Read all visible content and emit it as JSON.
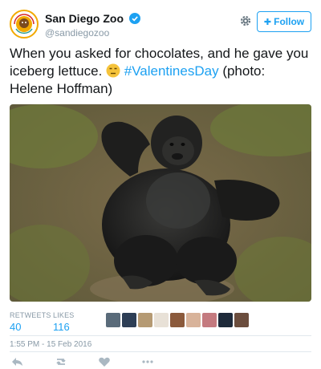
{
  "tweet": {
    "display_name": "San Diego Zoo",
    "handle": "@sandiegozoo",
    "follow_label": "Follow",
    "text_part1": "When you asked for chocolates, and he gave you iceberg lettuce. ",
    "hashtag": "#ValentinesDay",
    "text_part2": " (photo: Helene Hoffman)",
    "timestamp": "1:55 PM - 15 Feb 2016"
  },
  "stats": {
    "retweets_label": "RETWEETS",
    "retweets_value": "40",
    "likes_label": "LIKES",
    "likes_value": "116"
  },
  "liker_avatars": [
    "#5a6b7a",
    "#2d3e55",
    "#b59a73",
    "#e8e1d7",
    "#8b5a3c",
    "#d8b39a",
    "#c47a7f",
    "#1e2a3a",
    "#6b4d3d"
  ],
  "icons": {
    "verified": "verified-badge-icon",
    "settings": "gear-icon",
    "follow": "add-user-icon",
    "emoji": "unamused-face-emoji",
    "reply": "reply-icon",
    "retweet": "retweet-icon",
    "like": "heart-icon",
    "more": "more-icon"
  },
  "colors": {
    "accent": "#1da1f2",
    "muted": "#8899a6",
    "text": "#14171a"
  }
}
